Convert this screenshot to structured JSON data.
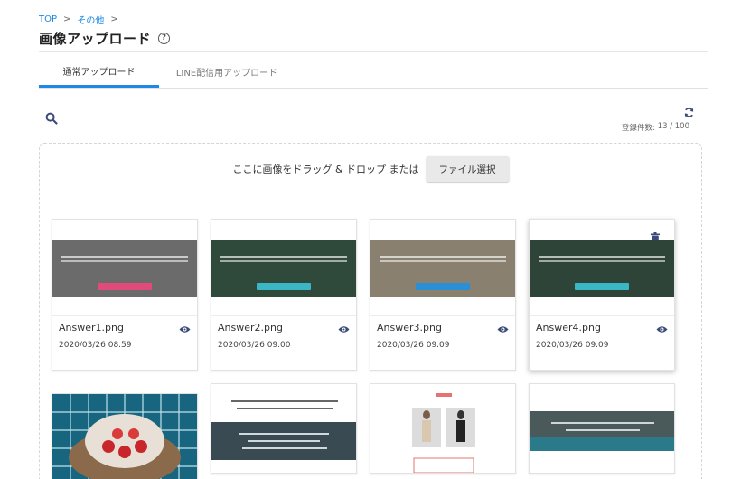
{
  "breadcrumb": {
    "items": [
      "TOP",
      "その他"
    ],
    "separator": ">"
  },
  "header": {
    "title": "画像アップロード",
    "help_icon": "help-circle-icon"
  },
  "tabs": [
    {
      "label": "通常アップロード",
      "active": true
    },
    {
      "label": "LINE配信用アップロード",
      "active": false
    }
  ],
  "toolbar": {
    "search_icon": "search-icon",
    "refresh_icon": "refresh-icon",
    "count_label": "登録件数:",
    "count_value": "13 / 100"
  },
  "dropzone": {
    "text": "ここに画像をドラッグ & ドロップ または",
    "button_label": "ファイル選択"
  },
  "images": [
    {
      "name": "Answer1.png",
      "date": "2020/03/26 08.59",
      "thumb_bg": "#6b6b6b",
      "thumb_btn": "#e14b7a"
    },
    {
      "name": "Answer2.png",
      "date": "2020/03/26 09.00",
      "thumb_bg": "#2f4a3a",
      "thumb_btn": "#3bb6c4"
    },
    {
      "name": "Answer3.png",
      "date": "2020/03/26 09.09",
      "thumb_bg": "#8a8070",
      "thumb_btn": "#2b8fd6"
    },
    {
      "name": "Answer4.png",
      "date": "2020/03/26 09.09",
      "thumb_bg": "#2e4438",
      "thumb_btn": "#3bb6c4"
    }
  ],
  "colors": {
    "accent": "#1e88e5",
    "icon": "#3a4a7a"
  }
}
